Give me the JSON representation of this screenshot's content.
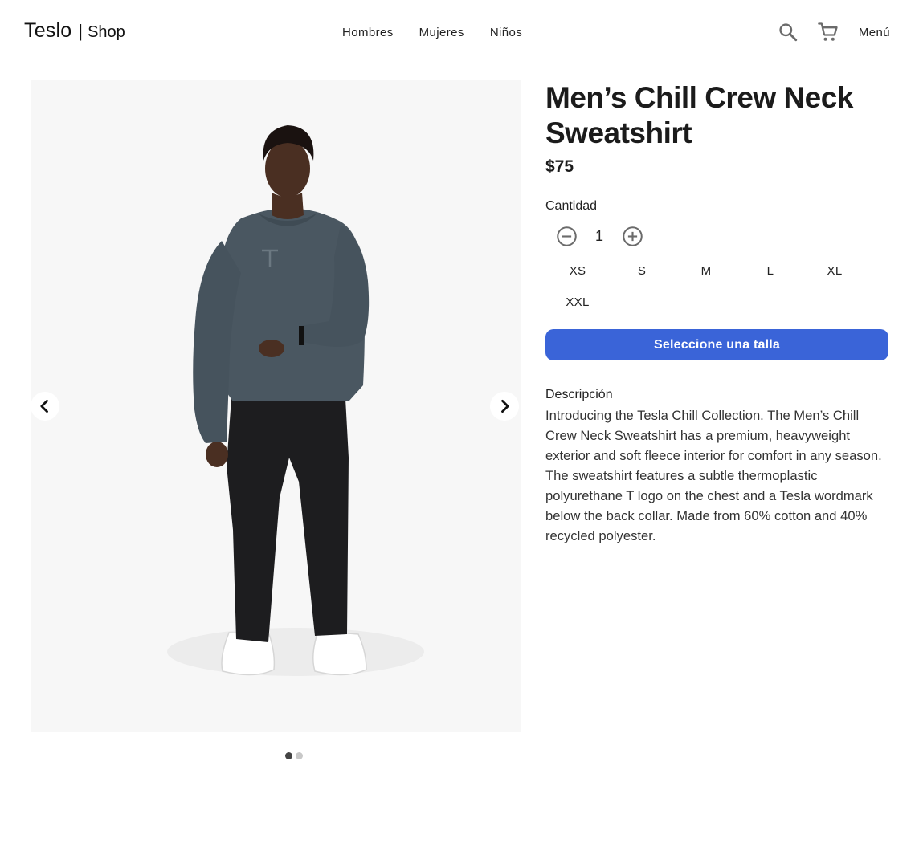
{
  "header": {
    "brand_name": "Teslo",
    "brand_separator": "|",
    "brand_sub": "Shop",
    "nav": [
      "Hombres",
      "Mujeres",
      "Niños"
    ],
    "menu_label": "Menú",
    "icons": [
      "search-icon",
      "cart-icon"
    ]
  },
  "gallery": {
    "image": "man-wearing-gray-crew-neck-sweatshirt",
    "slide_count": 2,
    "active_slide": 1,
    "icons": [
      "chevron-left-icon",
      "chevron-right-icon"
    ]
  },
  "product": {
    "title": "Men’s Chill Crew Neck Sweatshirt",
    "price": "$75",
    "quantity_label": "Cantidad",
    "quantity": "1",
    "sizes": [
      "XS",
      "S",
      "M",
      "L",
      "XL",
      "XXL"
    ],
    "cta_label": "Seleccione una talla",
    "description_label": "Descripción",
    "description": "Introducing the Tesla Chill Collection. The Men’s Chill Crew Neck Sweatshirt has a premium, heavyweight exterior and soft fleece interior for comfort in any season. The sweatshirt features a subtle thermoplastic polyurethane T logo on the chest and a Tesla wordmark below the back collar. Made from 60% cotton and 40% recycled polyester."
  },
  "colors": {
    "primary": "#3a64d8",
    "text": "#1b1b1b",
    "gallery_bg": "#f7f7f7",
    "sweatshirt": "#4a5761",
    "pants": "#1d1d1f"
  }
}
